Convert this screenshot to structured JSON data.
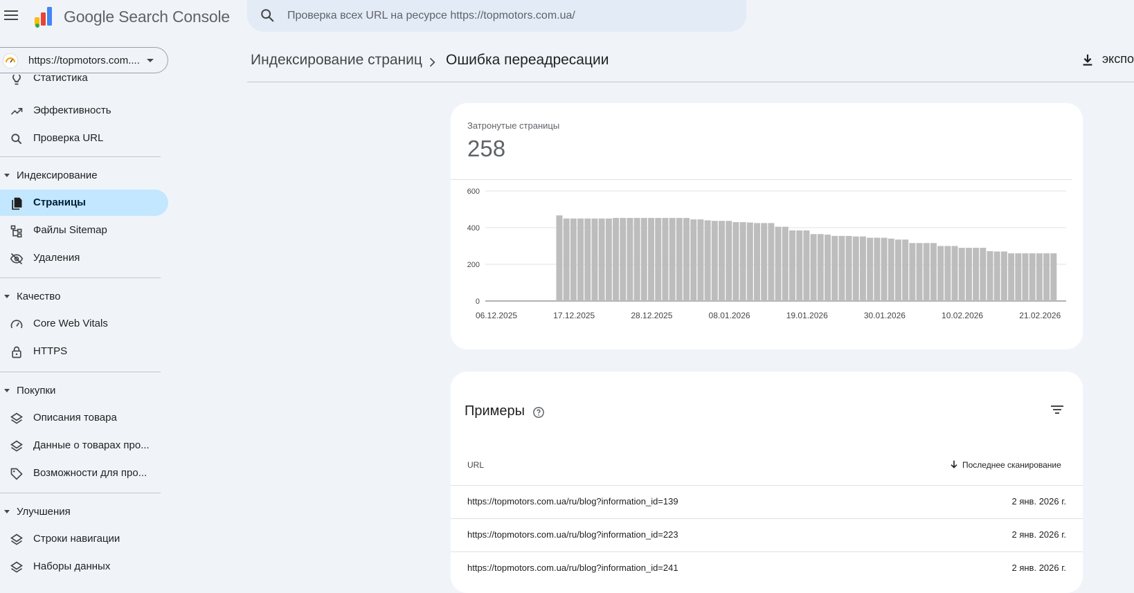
{
  "app": {
    "title": "Google Search Console"
  },
  "search": {
    "placeholder": "Проверка всех URL на ресурсе https://topmotors.com.ua/"
  },
  "property": {
    "label": "https://topmotors.com...."
  },
  "sidebar": {
    "items_top": [
      {
        "label": "Статистика",
        "icon": "bulb-icon"
      },
      {
        "label": "Эффективность",
        "icon": "trending-up-icon"
      },
      {
        "label": "Проверка URL",
        "icon": "search-icon"
      }
    ],
    "sections": [
      {
        "label": "Индексирование",
        "items": [
          {
            "label": "Страницы",
            "icon": "pages-icon",
            "active": true
          },
          {
            "label": "Файлы Sitemap",
            "icon": "sitemap-icon"
          },
          {
            "label": "Удаления",
            "icon": "visibility-off-icon"
          }
        ]
      },
      {
        "label": "Качество",
        "items": [
          {
            "label": "Core Web Vitals",
            "icon": "speed-icon"
          },
          {
            "label": "HTTPS",
            "icon": "lock-icon"
          }
        ]
      },
      {
        "label": "Покупки",
        "items": [
          {
            "label": "Описания товара",
            "icon": "layers-icon"
          },
          {
            "label": "Данные о товарах про...",
            "icon": "layers-icon"
          },
          {
            "label": "Возможности для про...",
            "icon": "tag-icon"
          }
        ]
      },
      {
        "label": "Улучшения",
        "items": [
          {
            "label": "Строки навигации",
            "icon": "layers-icon"
          },
          {
            "label": "Наборы данных",
            "icon": "layers-icon"
          }
        ]
      }
    ]
  },
  "breadcrumb": {
    "parent": "Индексирование страниц",
    "current": "Ошибка переадресации"
  },
  "toolbar": {
    "export_label": "экспо"
  },
  "summary": {
    "label": "Затронутые страницы",
    "value": "258"
  },
  "chart_data": {
    "type": "bar",
    "title": "",
    "xlabel": "",
    "ylabel": "",
    "ylim": [
      0,
      600
    ],
    "yticks": [
      0,
      200,
      400,
      600
    ],
    "xtick_labels": [
      "06.12.2025",
      "17.12.2025",
      "28.12.2025",
      "08.01.2026",
      "19.01.2026",
      "30.01.2026",
      "10.02.2026",
      "21.02.2026"
    ],
    "grid": true,
    "color": "#bdbdbd",
    "start_date": "2025-12-06",
    "values": [
      0,
      0,
      0,
      0,
      0,
      0,
      0,
      0,
      0,
      0,
      467,
      450,
      450,
      450,
      450,
      450,
      450,
      450,
      453,
      453,
      453,
      453,
      453,
      453,
      453,
      453,
      453,
      453,
      453,
      445,
      445,
      440,
      437,
      437,
      437,
      430,
      430,
      428,
      425,
      425,
      425,
      405,
      405,
      385,
      385,
      385,
      365,
      365,
      362,
      355,
      355,
      355,
      352,
      352,
      345,
      345,
      345,
      340,
      335,
      335,
      316,
      316,
      316,
      316,
      300,
      300,
      300,
      290,
      290,
      290,
      290,
      272,
      270,
      270,
      260,
      260,
      260,
      260,
      260,
      260,
      260
    ]
  },
  "examples": {
    "title": "Примеры",
    "col_url": "URL",
    "col_last": "Последнее сканирование",
    "rows": [
      {
        "url": "https://topmotors.com.ua/ru/blog?information_id=139",
        "date": "2 янв. 2026 г."
      },
      {
        "url": "https://topmotors.com.ua/ru/blog?information_id=223",
        "date": "2 янв. 2026 г."
      },
      {
        "url": "https://topmotors.com.ua/ru/blog?information_id=241",
        "date": "2 янв. 2026 г."
      }
    ]
  }
}
